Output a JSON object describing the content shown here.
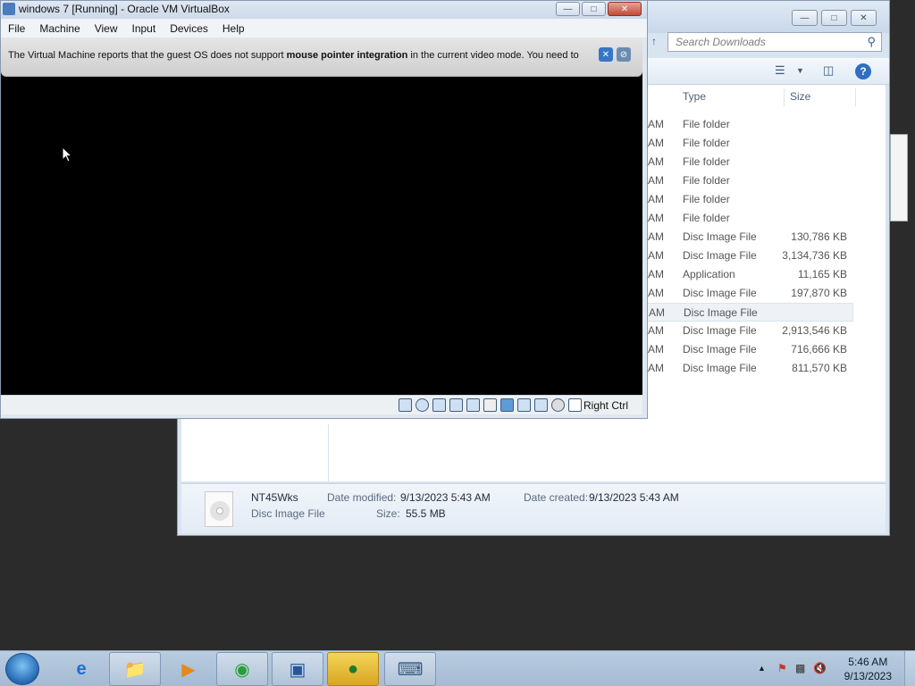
{
  "explorer": {
    "search_placeholder": "Search Downloads",
    "columns": {
      "type": "Type",
      "size": "Size"
    },
    "rows": [
      {
        "time_fragment": "AM",
        "type": "File folder",
        "size": ""
      },
      {
        "time_fragment": "AM",
        "type": "File folder",
        "size": ""
      },
      {
        "time_fragment": "AM",
        "type": "File folder",
        "size": ""
      },
      {
        "time_fragment": "AM",
        "type": "File folder",
        "size": ""
      },
      {
        "time_fragment": "AM",
        "type": "File folder",
        "size": ""
      },
      {
        "time_fragment": "AM",
        "type": "File folder",
        "size": ""
      },
      {
        "time_fragment": "AM",
        "type": "Disc Image File",
        "size": "130,786 KB"
      },
      {
        "time_fragment": "AM",
        "type": "Disc Image File",
        "size": "3,134,736 KB"
      },
      {
        "time_fragment": "AM",
        "type": "Application",
        "size": "11,165 KB"
      },
      {
        "time_fragment": "AM",
        "type": "Disc Image File",
        "size": "197,870 KB"
      },
      {
        "time_fragment": "AM",
        "type": "Disc Image File",
        "size": "56,876 KB"
      },
      {
        "time_fragment": "AM",
        "type": "Disc Image File",
        "size": "2,913,546 KB"
      },
      {
        "time_fragment": "AM",
        "type": "Disc Image File",
        "size": "716,666 KB"
      },
      {
        "time_fragment": "AM",
        "type": "Disc Image File",
        "size": "811,570 KB"
      }
    ],
    "details": {
      "name": "NT45Wks",
      "type": "Disc Image File",
      "modified_label": "Date modified:",
      "modified_value": "9/13/2023 5:43 AM",
      "created_label": "Date created:",
      "created_value": "9/13/2023 5:43 AM",
      "size_label": "Size:",
      "size_value": "55.5 MB"
    }
  },
  "vbox": {
    "title": "windows 7 [Running] - Oracle VM VirtualBox",
    "menu": [
      "File",
      "Machine",
      "View",
      "Input",
      "Devices",
      "Help"
    ],
    "notice_pre": "The Virtual Machine reports that the guest OS does not support ",
    "notice_bold": "mouse pointer integration",
    "notice_post": " in the current video mode. You need to",
    "host_key": "Right Ctrl"
  },
  "taskbar": {
    "clock_time": "5:46 AM",
    "clock_date": "9/13/2023",
    "apps": [
      "internet-explorer-icon",
      "file-explorer-icon",
      "media-player-icon",
      "chrome-icon",
      "virtualbox-icon",
      "download-manager-icon",
      "remote-desktop-icon"
    ]
  },
  "colors": {
    "taskbar": "#a5bbd3",
    "vm_screen": "#000000",
    "selected_row": "#eef2f7",
    "close_button": "#c24a36"
  }
}
